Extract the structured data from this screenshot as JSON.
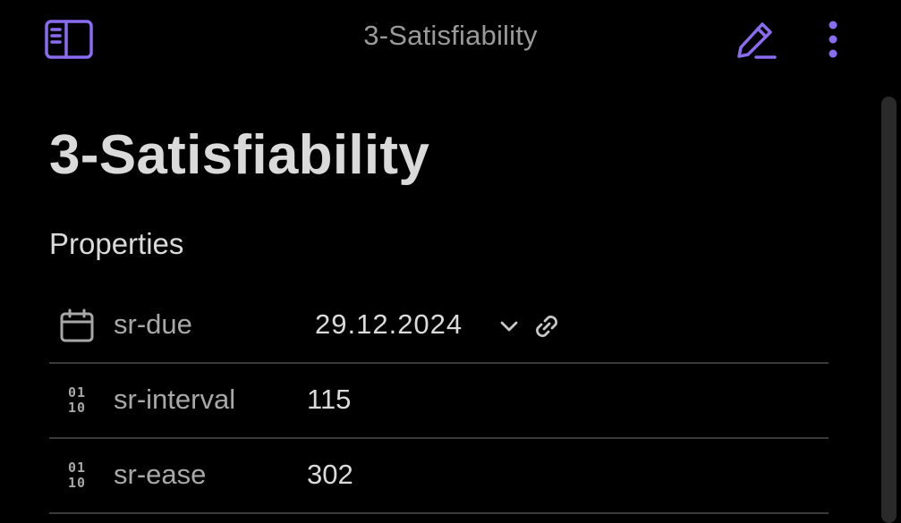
{
  "app": {
    "window_title": "3-Satisfiability",
    "accent_color": "#8b6cf0"
  },
  "toolbar": {
    "sidebar_toggle_icon": "sidebar-toggle-icon",
    "edit_icon": "pencil-icon",
    "more_icon": "more-vertical-icon"
  },
  "note": {
    "title": "3-Satisfiability",
    "properties_heading": "Properties",
    "properties": [
      {
        "icon": "calendar-icon",
        "key": "sr-due",
        "value": "29.12.2024",
        "type": "date"
      },
      {
        "icon": "binary-number-icon",
        "key": "sr-interval",
        "value": "115",
        "type": "number"
      },
      {
        "icon": "binary-number-icon",
        "key": "sr-ease",
        "value": "302",
        "type": "number"
      }
    ],
    "binary_icon_glyph_top": "01",
    "binary_icon_glyph_bottom": "10"
  }
}
